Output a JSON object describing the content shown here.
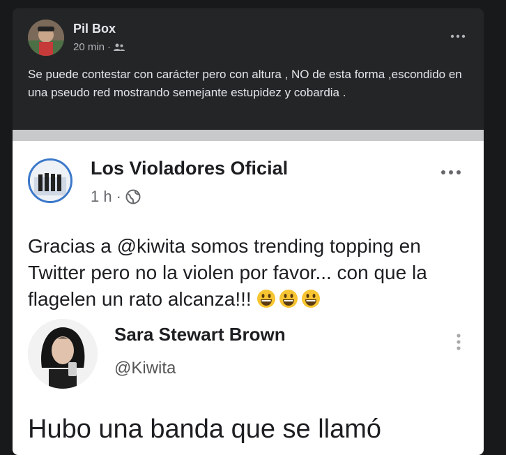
{
  "post": {
    "author": "Pil Box",
    "time": "20 min",
    "audience_icon": "friends-icon",
    "text": "Se puede contestar con carácter pero  con altura , NO  de esta forma ,escondido en una pseudo red mostrando semejante estupidez  y cobardia ."
  },
  "screenshot": {
    "page_name": "Los Violadores Oficial",
    "page_time": "1 h",
    "page_privacy_icon": "globe-icon",
    "body": "Gracias a @kiwita somos trending topping en Twitter pero no la violen por favor... con que la flagelen un rato alcanza!!!",
    "emoji_count_icon": "grinning-face-icon",
    "tweet": {
      "name": "Sara Stewart Brown",
      "handle": "@Kiwita",
      "text": "Hubo una banda que se llamó"
    }
  },
  "colors": {
    "dark_bg": "#18191a",
    "card_bg": "#242526",
    "accent_ring": "#3b78c9"
  }
}
